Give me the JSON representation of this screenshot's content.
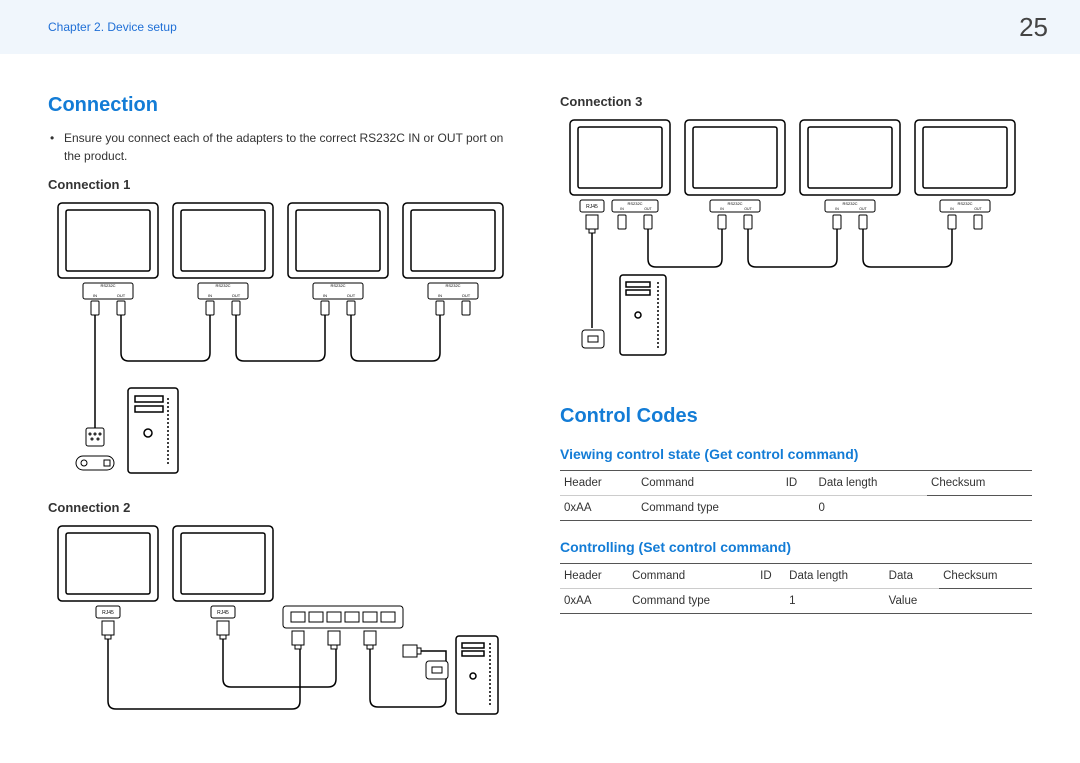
{
  "header": {
    "chapter": "Chapter 2. Device setup",
    "page": "25"
  },
  "left": {
    "section": "Connection",
    "bullet": "Ensure you connect each of the adapters to the correct RS232C IN or OUT port on the product.",
    "conn1": "Connection 1",
    "conn2": "Connection 2"
  },
  "right": {
    "conn3": "Connection 3",
    "section": "Control Codes",
    "sub1": "Viewing control state (Get control command)",
    "sub2": "Controlling (Set control command)",
    "table1": {
      "h1": "Header",
      "h2": "Command",
      "h3": "ID",
      "h4": "Data length",
      "h5": "Checksum",
      "r1": "0xAA",
      "r2": "Command type",
      "r3": "",
      "r4": "0",
      "r5": ""
    },
    "table2": {
      "h1": "Header",
      "h2": "Command",
      "h3": "ID",
      "h4": "Data length",
      "h5": "Data",
      "h6": "Checksum",
      "r1": "0xAA",
      "r2": "Command type",
      "r3": "",
      "r4": "1",
      "r5": "Value",
      "r6": ""
    }
  },
  "svg_labels": {
    "rs232c": "RS232C",
    "in": "IN",
    "out": "OUT",
    "rj45": "RJ45"
  }
}
